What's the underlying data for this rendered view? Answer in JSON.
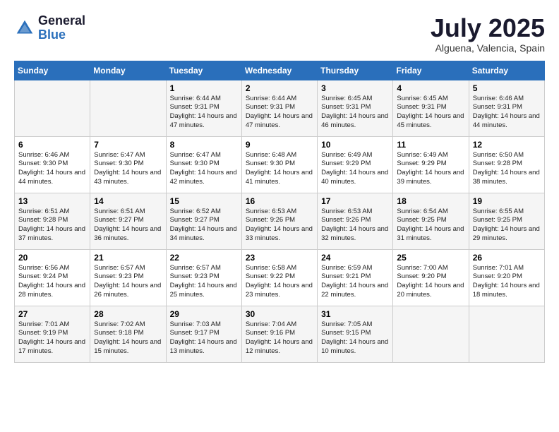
{
  "logo": {
    "general": "General",
    "blue": "Blue"
  },
  "title": "July 2025",
  "location": "Alguena, Valencia, Spain",
  "weekdays": [
    "Sunday",
    "Monday",
    "Tuesday",
    "Wednesday",
    "Thursday",
    "Friday",
    "Saturday"
  ],
  "weeks": [
    [
      {
        "day": "",
        "info": ""
      },
      {
        "day": "",
        "info": ""
      },
      {
        "day": "1",
        "info": "Sunrise: 6:44 AM\nSunset: 9:31 PM\nDaylight: 14 hours and 47 minutes."
      },
      {
        "day": "2",
        "info": "Sunrise: 6:44 AM\nSunset: 9:31 PM\nDaylight: 14 hours and 47 minutes."
      },
      {
        "day": "3",
        "info": "Sunrise: 6:45 AM\nSunset: 9:31 PM\nDaylight: 14 hours and 46 minutes."
      },
      {
        "day": "4",
        "info": "Sunrise: 6:45 AM\nSunset: 9:31 PM\nDaylight: 14 hours and 45 minutes."
      },
      {
        "day": "5",
        "info": "Sunrise: 6:46 AM\nSunset: 9:31 PM\nDaylight: 14 hours and 44 minutes."
      }
    ],
    [
      {
        "day": "6",
        "info": "Sunrise: 6:46 AM\nSunset: 9:30 PM\nDaylight: 14 hours and 44 minutes."
      },
      {
        "day": "7",
        "info": "Sunrise: 6:47 AM\nSunset: 9:30 PM\nDaylight: 14 hours and 43 minutes."
      },
      {
        "day": "8",
        "info": "Sunrise: 6:47 AM\nSunset: 9:30 PM\nDaylight: 14 hours and 42 minutes."
      },
      {
        "day": "9",
        "info": "Sunrise: 6:48 AM\nSunset: 9:30 PM\nDaylight: 14 hours and 41 minutes."
      },
      {
        "day": "10",
        "info": "Sunrise: 6:49 AM\nSunset: 9:29 PM\nDaylight: 14 hours and 40 minutes."
      },
      {
        "day": "11",
        "info": "Sunrise: 6:49 AM\nSunset: 9:29 PM\nDaylight: 14 hours and 39 minutes."
      },
      {
        "day": "12",
        "info": "Sunrise: 6:50 AM\nSunset: 9:28 PM\nDaylight: 14 hours and 38 minutes."
      }
    ],
    [
      {
        "day": "13",
        "info": "Sunrise: 6:51 AM\nSunset: 9:28 PM\nDaylight: 14 hours and 37 minutes."
      },
      {
        "day": "14",
        "info": "Sunrise: 6:51 AM\nSunset: 9:27 PM\nDaylight: 14 hours and 36 minutes."
      },
      {
        "day": "15",
        "info": "Sunrise: 6:52 AM\nSunset: 9:27 PM\nDaylight: 14 hours and 34 minutes."
      },
      {
        "day": "16",
        "info": "Sunrise: 6:53 AM\nSunset: 9:26 PM\nDaylight: 14 hours and 33 minutes."
      },
      {
        "day": "17",
        "info": "Sunrise: 6:53 AM\nSunset: 9:26 PM\nDaylight: 14 hours and 32 minutes."
      },
      {
        "day": "18",
        "info": "Sunrise: 6:54 AM\nSunset: 9:25 PM\nDaylight: 14 hours and 31 minutes."
      },
      {
        "day": "19",
        "info": "Sunrise: 6:55 AM\nSunset: 9:25 PM\nDaylight: 14 hours and 29 minutes."
      }
    ],
    [
      {
        "day": "20",
        "info": "Sunrise: 6:56 AM\nSunset: 9:24 PM\nDaylight: 14 hours and 28 minutes."
      },
      {
        "day": "21",
        "info": "Sunrise: 6:57 AM\nSunset: 9:23 PM\nDaylight: 14 hours and 26 minutes."
      },
      {
        "day": "22",
        "info": "Sunrise: 6:57 AM\nSunset: 9:23 PM\nDaylight: 14 hours and 25 minutes."
      },
      {
        "day": "23",
        "info": "Sunrise: 6:58 AM\nSunset: 9:22 PM\nDaylight: 14 hours and 23 minutes."
      },
      {
        "day": "24",
        "info": "Sunrise: 6:59 AM\nSunset: 9:21 PM\nDaylight: 14 hours and 22 minutes."
      },
      {
        "day": "25",
        "info": "Sunrise: 7:00 AM\nSunset: 9:20 PM\nDaylight: 14 hours and 20 minutes."
      },
      {
        "day": "26",
        "info": "Sunrise: 7:01 AM\nSunset: 9:20 PM\nDaylight: 14 hours and 18 minutes."
      }
    ],
    [
      {
        "day": "27",
        "info": "Sunrise: 7:01 AM\nSunset: 9:19 PM\nDaylight: 14 hours and 17 minutes."
      },
      {
        "day": "28",
        "info": "Sunrise: 7:02 AM\nSunset: 9:18 PM\nDaylight: 14 hours and 15 minutes."
      },
      {
        "day": "29",
        "info": "Sunrise: 7:03 AM\nSunset: 9:17 PM\nDaylight: 14 hours and 13 minutes."
      },
      {
        "day": "30",
        "info": "Sunrise: 7:04 AM\nSunset: 9:16 PM\nDaylight: 14 hours and 12 minutes."
      },
      {
        "day": "31",
        "info": "Sunrise: 7:05 AM\nSunset: 9:15 PM\nDaylight: 14 hours and 10 minutes."
      },
      {
        "day": "",
        "info": ""
      },
      {
        "day": "",
        "info": ""
      }
    ]
  ]
}
